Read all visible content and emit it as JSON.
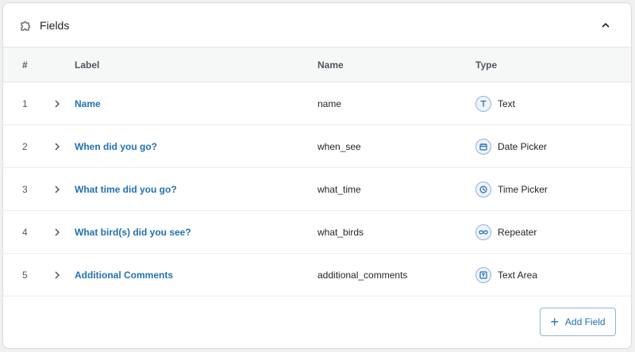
{
  "panel": {
    "title": "Fields"
  },
  "table": {
    "headers": {
      "num": "#",
      "label": "Label",
      "name": "Name",
      "type": "Type"
    },
    "rows": [
      {
        "num": "1",
        "label": "Name",
        "name": "name",
        "type": "Text",
        "icon": "text-type-icon"
      },
      {
        "num": "2",
        "label": "When did you go?",
        "name": "when_see",
        "type": "Date Picker",
        "icon": "calendar-icon"
      },
      {
        "num": "3",
        "label": "What time did you go?",
        "name": "what_time",
        "type": "Time Picker",
        "icon": "clock-icon"
      },
      {
        "num": "4",
        "label": "What bird(s) did you see?",
        "name": "what_birds",
        "type": "Repeater",
        "icon": "infinity-icon"
      },
      {
        "num": "5",
        "label": "Additional Comments",
        "name": "additional_comments",
        "type": "Text Area",
        "icon": "textarea-icon"
      }
    ]
  },
  "footer": {
    "add_label": "Add Field"
  },
  "colors": {
    "link": "#2271b1",
    "icon_bg": "#eef3f9",
    "border": "#dcdcde"
  }
}
